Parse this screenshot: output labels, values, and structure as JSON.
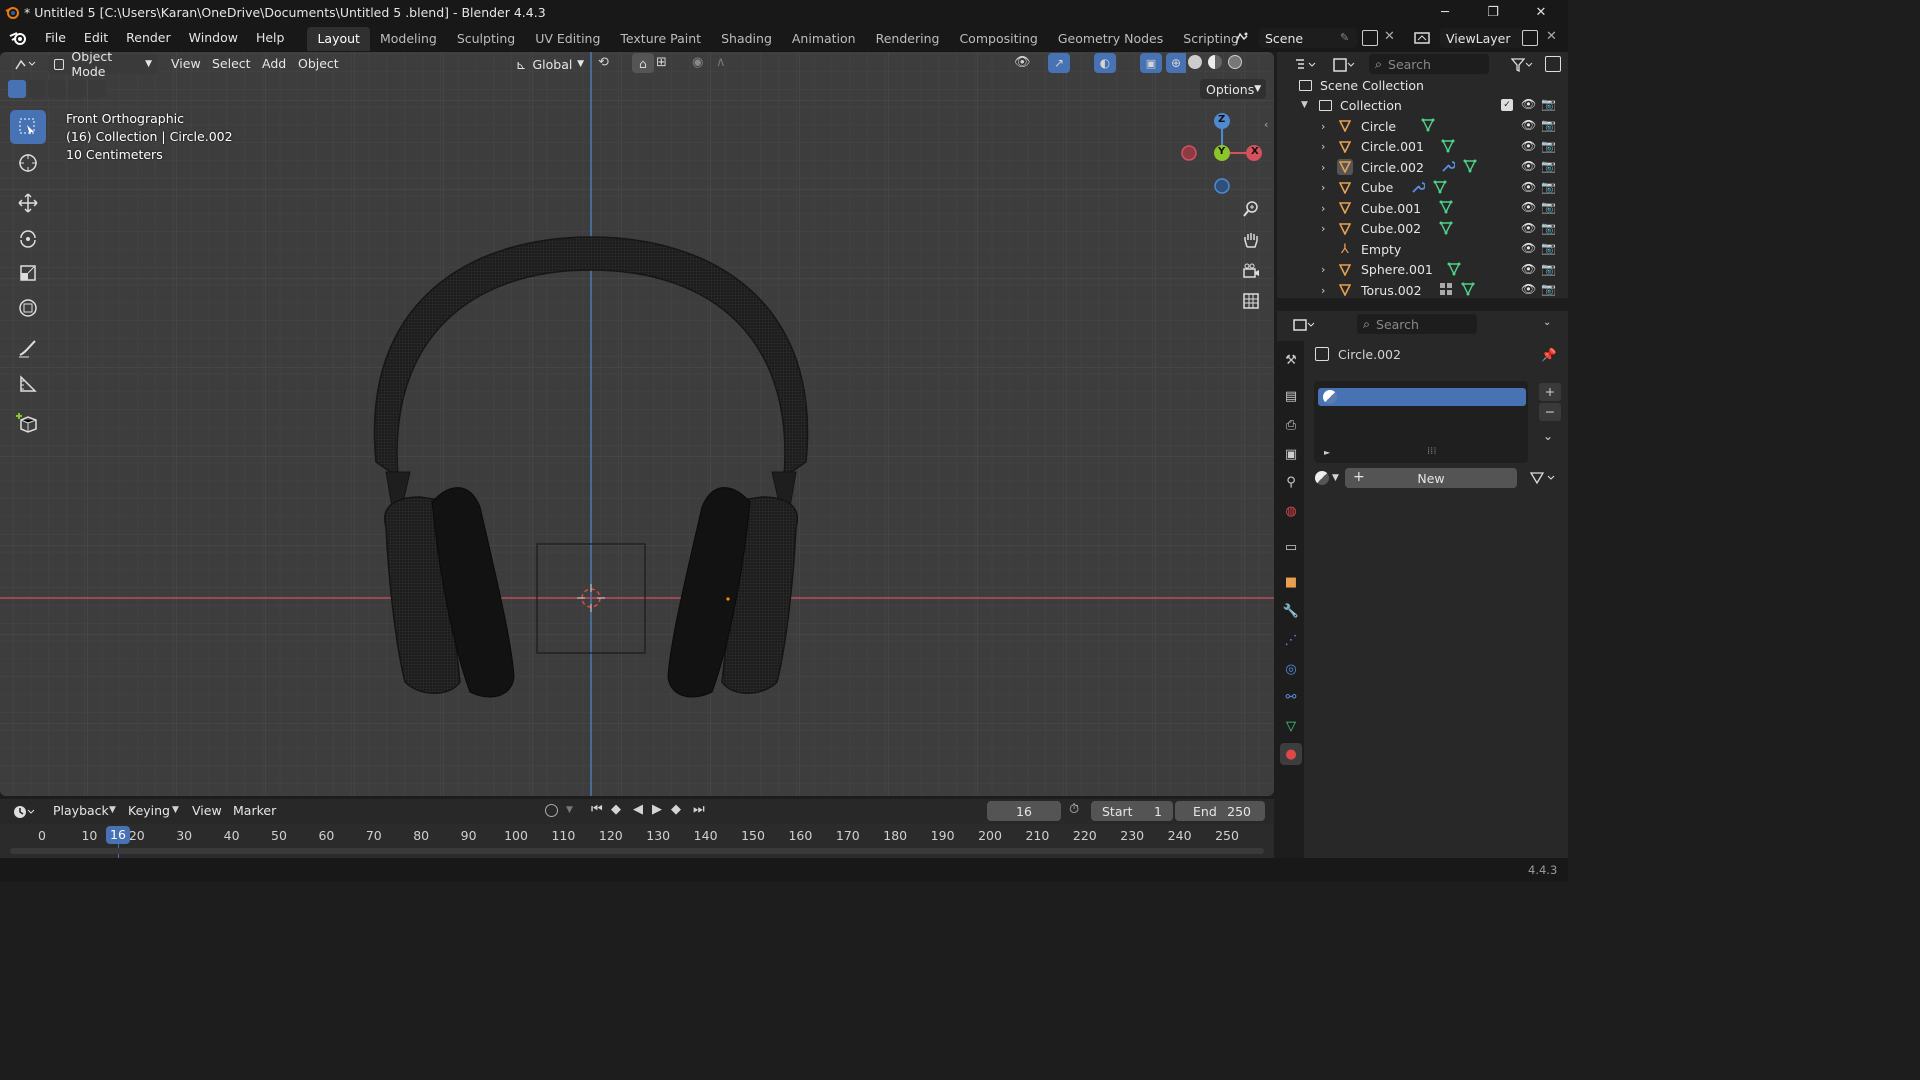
{
  "window": {
    "title": "* Untitled 5  [C:\\Users\\Karan\\OneDrive\\Documents\\Untitled 5 .blend] - Blender 4.4.3",
    "app_icon": "blender-icon"
  },
  "menubar": {
    "items": [
      "File",
      "Edit",
      "Render",
      "Window",
      "Help"
    ],
    "workspaces": [
      "Layout",
      "Modeling",
      "Sculpting",
      "UV Editing",
      "Texture Paint",
      "Shading",
      "Animation",
      "Rendering",
      "Compositing",
      "Geometry Nodes",
      "Scripting"
    ],
    "active_workspace": "Layout",
    "scene": "Scene",
    "view_layer": "ViewLayer"
  },
  "viewport": {
    "mode": "Object Mode",
    "menus": [
      "View",
      "Select",
      "Add",
      "Object"
    ],
    "transform_orientation": "Global",
    "options_label": "Options",
    "overlay": {
      "view_name": "Front Orthographic",
      "collection_info": "(16) Collection | Circle.002",
      "scale": "10 Centimeters"
    },
    "gizmo": {
      "z": "Z",
      "y": "Y",
      "x": "X"
    },
    "colors": {
      "background": "#3d3d3d",
      "x_axis": "#d3525e",
      "z_axis": "#4f8ad1",
      "y_axis": "#8bc52b"
    }
  },
  "outliner": {
    "search_placeholder": "Search",
    "scene_collection": "Scene Collection",
    "collection": "Collection",
    "objects": [
      {
        "name": "Circle"
      },
      {
        "name": "Circle.001"
      },
      {
        "name": "Circle.002"
      },
      {
        "name": "Cube"
      },
      {
        "name": "Cube.001"
      },
      {
        "name": "Cube.002"
      },
      {
        "name": "Empty"
      },
      {
        "name": "Sphere.001"
      },
      {
        "name": "Torus.002"
      }
    ]
  },
  "properties": {
    "search_placeholder": "Search",
    "object_name": "Circle.002",
    "new_label": "New",
    "tabs": [
      "tool",
      "render",
      "output",
      "view-layer",
      "scene",
      "world",
      "collection",
      "object",
      "modifier",
      "particles",
      "physics",
      "constraints",
      "data",
      "material"
    ]
  },
  "timeline": {
    "menus": [
      "Playback",
      "Keying",
      "View",
      "Marker"
    ],
    "current_frame": "16",
    "start_label": "Start",
    "start": "1",
    "end_label": "End",
    "end": "250",
    "ticks": [
      "0",
      "10",
      "16",
      "20",
      "30",
      "40",
      "50",
      "60",
      "70",
      "80",
      "90",
      "100",
      "110",
      "120",
      "130",
      "140",
      "150",
      "160",
      "170",
      "180",
      "190",
      "200",
      "210",
      "220",
      "230",
      "240",
      "250"
    ]
  },
  "statusbar": {
    "version": "4.4.3"
  }
}
